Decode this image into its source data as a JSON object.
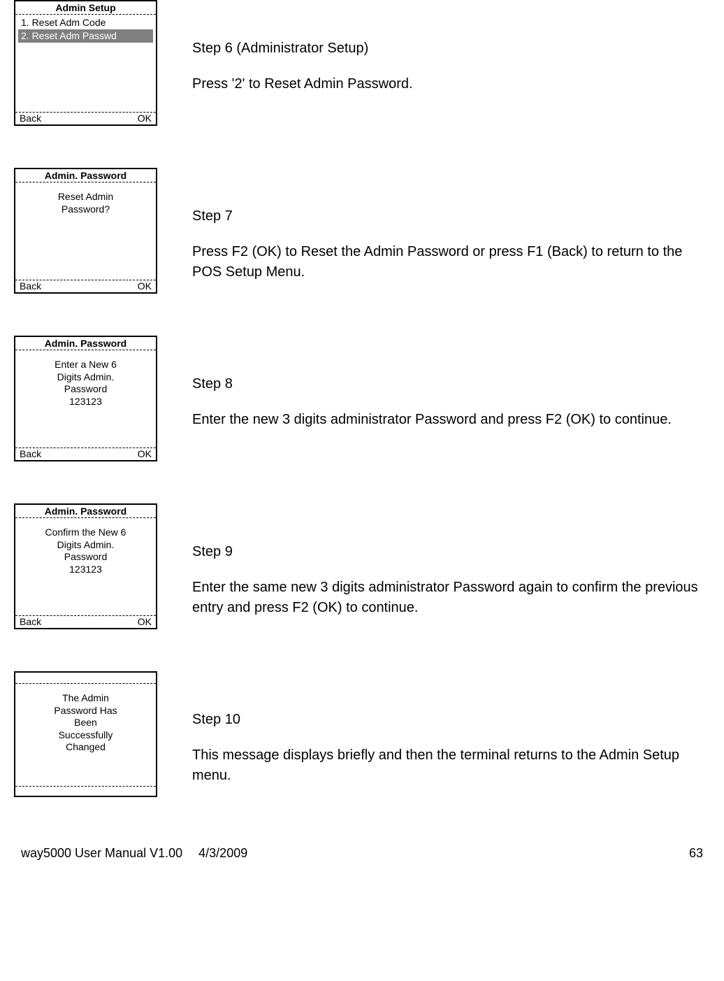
{
  "steps": [
    {
      "screen": {
        "title": "Admin Setup",
        "type": "menu",
        "items": [
          {
            "text": "1. Reset Adm Code",
            "selected": false
          },
          {
            "text": "2. Reset Adm Passwd",
            "selected": true
          }
        ],
        "back": "Back",
        "ok": "OK"
      },
      "desc_title": "Step 6 (Administrator Setup)",
      "desc_body": "Press '2' to Reset Admin Password."
    },
    {
      "screen": {
        "title": "Admin. Password",
        "type": "message",
        "lines": [
          "Reset Admin",
          "Password?"
        ],
        "back": "Back",
        "ok": "OK"
      },
      "desc_title": "Step 7",
      "desc_body": "Press F2 (OK) to Reset the Admin Password or press F1 (Back) to return to the POS Setup Menu."
    },
    {
      "screen": {
        "title": "Admin. Password",
        "type": "message",
        "lines": [
          "Enter a New 6",
          "Digits Admin.",
          "Password",
          "123123"
        ],
        "back": "Back",
        "ok": "OK"
      },
      "desc_title": "Step 8",
      "desc_body": "Enter the new 3 digits administrator Password and press F2 (OK) to continue."
    },
    {
      "screen": {
        "title": "Admin. Password",
        "type": "message",
        "lines": [
          "Confirm the New 6",
          "Digits Admin.",
          "Password",
          "123123"
        ],
        "back": "Back",
        "ok": "OK"
      },
      "desc_title": "Step 9",
      "desc_body": "Enter the same new 3 digits administrator Password again to confirm the previous entry and press F2 (OK) to continue."
    },
    {
      "screen": {
        "title": "",
        "type": "message",
        "lines": [
          "The Admin",
          "Password Has",
          "Been",
          "Successfully",
          "Changed"
        ],
        "back": "",
        "ok": ""
      },
      "desc_title": "Step 10",
      "desc_body": "This message displays briefly and then the terminal returns to the Admin Setup menu."
    }
  ],
  "footer": {
    "manual": "way5000 User Manual V1.00",
    "date": "4/3/2009",
    "page": "63"
  }
}
